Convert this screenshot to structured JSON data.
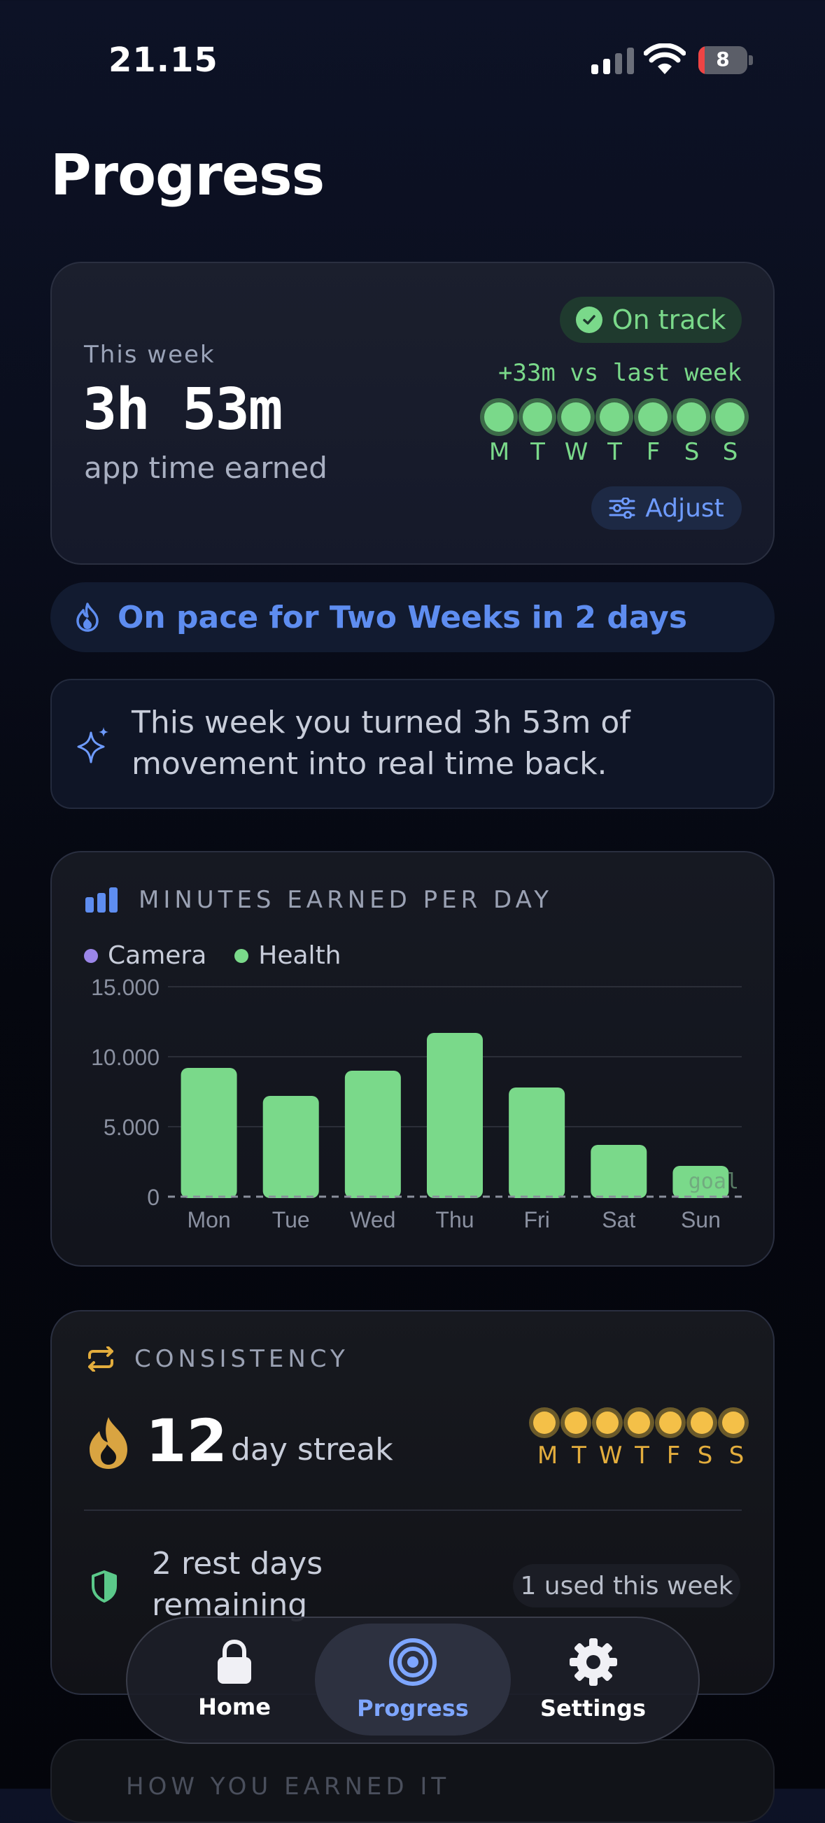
{
  "status_bar": {
    "time": "21.15",
    "battery_level": "8"
  },
  "page": {
    "title": "Progress"
  },
  "week_card": {
    "label": "This week",
    "value": "3h 53m",
    "subtitle": "app time earned",
    "status_badge": "On track",
    "comparison": "+33m vs last week",
    "day_letters": [
      "M",
      "T",
      "W",
      "T",
      "F",
      "S",
      "S"
    ],
    "adjust_label": "Adjust"
  },
  "pace_banner": {
    "text": "On pace for Two Weeks in 2 days"
  },
  "insight": {
    "text": "This week you turned 3h 53m of movement into real time back."
  },
  "minutes_card": {
    "title": "MINUTES EARNED PER DAY",
    "legend": [
      {
        "label": "Camera",
        "color": "#9b86e8"
      },
      {
        "label": "Health",
        "color": "#7ad98a"
      }
    ]
  },
  "chart_data": {
    "type": "bar",
    "categories": [
      "Mon",
      "Tue",
      "Wed",
      "Thu",
      "Fri",
      "Sat",
      "Sun"
    ],
    "series": [
      {
        "name": "Camera",
        "values": [
          0,
          0,
          0,
          0,
          0,
          0,
          0
        ]
      },
      {
        "name": "Health",
        "values": [
          9200,
          7200,
          9000,
          11700,
          7800,
          3700,
          2200
        ]
      }
    ],
    "ylim": [
      0,
      15000
    ],
    "yticks": [
      "0",
      "5.000",
      "10.000",
      "15.000"
    ],
    "ytick_values": [
      0,
      5000,
      10000,
      15000
    ],
    "goal_label": "goal",
    "grid": true,
    "legend_position": "top-left",
    "bar_color": "#7ad98a"
  },
  "consistency_card": {
    "title": "CONSISTENCY",
    "streak_number": "12",
    "streak_label": "day streak",
    "day_letters": [
      "M",
      "T",
      "W",
      "T",
      "F",
      "S",
      "S"
    ],
    "rest_days": "2 rest days remaining",
    "used_badge": "1 used this week"
  },
  "next_section": {
    "title": "HOW YOU EARNED IT"
  },
  "tab_bar": {
    "home": "Home",
    "progress": "Progress",
    "settings": "Settings",
    "active": "progress"
  }
}
